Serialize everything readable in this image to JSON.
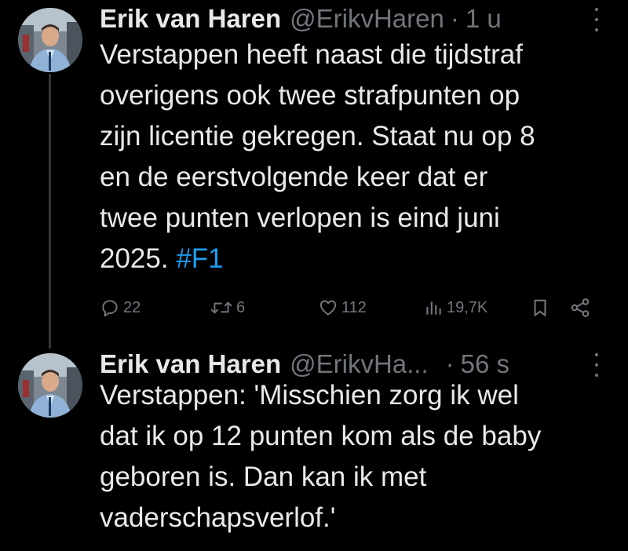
{
  "tweets": [
    {
      "author_name": "Erik van Haren",
      "handle": "@ErikvHaren",
      "separator": "·",
      "time": "1 u",
      "text_lines": [
        "Verstappen heeft naast die tijdstraf",
        "overigens ook twee strafpunten op",
        "zijn licentie gekregen. Staat nu op 8",
        "en de eerstvolgende keer dat er",
        "twee punten verlopen is eind juni"
      ],
      "text_last_line_prefix": "2025. ",
      "hashtag": "#F1",
      "actions": {
        "replies": "22",
        "retweets": "6",
        "likes": "112",
        "views": "19,7K"
      },
      "icons": [
        "reply-icon",
        "retweet-icon",
        "like-icon",
        "views-icon",
        "bookmark-icon",
        "share-icon"
      ]
    },
    {
      "author_name": "Erik van Haren",
      "handle": "@ErikvHa...",
      "separator": "·",
      "time": "56 s",
      "text_lines": [
        "Verstappen: 'Misschien zorg ik wel",
        "dat ik op 12 punten kom als de baby",
        "geboren is. Dan kan ik met",
        "vaderschapsverlof.'"
      ]
    }
  ],
  "colors": {
    "background": "#000000",
    "text": "#e7e9ea",
    "secondary": "#71767b",
    "link": "#1d9bf0",
    "thread_line": "#333639"
  }
}
